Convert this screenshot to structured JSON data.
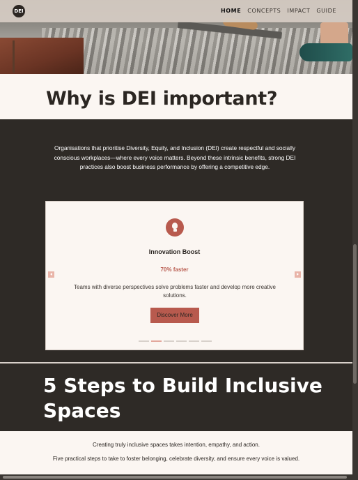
{
  "nav": {
    "logo_text": "DEI",
    "links": [
      "HOME",
      "CONCEPTS",
      "IMPACT",
      "GUIDE"
    ],
    "active": "HOME"
  },
  "why": {
    "title": "Why is DEI important?",
    "intro": "Organisations that prioritise Diversity, Equity, and Inclusion (DEI) create respectful and socially conscious workplaces—where every voice matters. Beyond these intrinsic benefits, strong DEI practices also boost business performance by offering a competitive edge."
  },
  "carousel": {
    "icon": "lightbulb-icon",
    "title": "Innovation Boost",
    "stat": "70% faster",
    "description": "Teams with diverse perspectives solve problems faster and develop more creative solutions.",
    "button_label": "Discover More",
    "slide_count": 6,
    "active_slide": 2
  },
  "steps": {
    "title": "5 Steps to Build Inclusive Spaces",
    "line1": "Creating truly inclusive spaces takes intention, empathy, and action.",
    "line2": "Five practical steps to take to foster belonging, celebrate diversity, and ensure every voice is valued."
  },
  "colors": {
    "accent": "#b85a4e",
    "dark": "#2e2a26",
    "cream": "#fbf6f2"
  }
}
